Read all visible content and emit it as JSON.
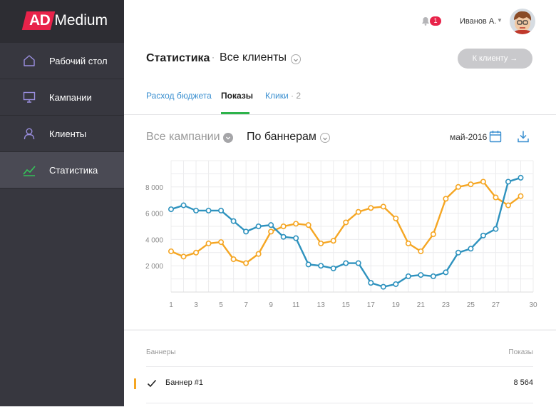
{
  "app": {
    "logo_highlight": "AD",
    "logo_rest": "Medium",
    "brand_color": "#e8234a"
  },
  "sidebar": {
    "items": [
      {
        "label": "Рабочий стол",
        "icon": "home-icon",
        "active": false
      },
      {
        "label": "Кампании",
        "icon": "monitor-icon",
        "active": false
      },
      {
        "label": "Клиенты",
        "icon": "user-icon",
        "active": false
      },
      {
        "label": "Статистика",
        "icon": "chart-line-icon",
        "active": true
      }
    ]
  },
  "topbar": {
    "notifications_count": "1",
    "user_name": "Иванов А."
  },
  "header": {
    "title": "Статистика",
    "separator": "·",
    "client": "Все клиенты",
    "cta_label": "К клиенту  →",
    "tabs": [
      {
        "label": "Расход бюджета",
        "active": false
      },
      {
        "label": "Показы",
        "active": true
      },
      {
        "label": "Клики",
        "count": "· 2",
        "active": false
      }
    ]
  },
  "filters": {
    "campaigns": "Все кампании",
    "grouping": "По баннерам",
    "period": "май-2016"
  },
  "chart_data": {
    "type": "line",
    "x": [
      1,
      2,
      3,
      4,
      5,
      6,
      7,
      8,
      9,
      10,
      11,
      12,
      13,
      14,
      15,
      16,
      17,
      18,
      19,
      20,
      21,
      22,
      23,
      24,
      25,
      26,
      27,
      28,
      29,
      30
    ],
    "x_tick_labels": [
      "1",
      "3",
      "5",
      "7",
      "9",
      "11",
      "13",
      "15",
      "17",
      "19",
      "21",
      "23",
      "25",
      "27",
      "30"
    ],
    "y_tick_labels": [
      "2 000",
      "4 000",
      "6 000",
      "8 000"
    ],
    "ylim": [
      0,
      10000
    ],
    "grid": true,
    "series": [
      {
        "color": "#2e92be",
        "values": [
          6300,
          6600,
          6200,
          6200,
          6200,
          5400,
          4600,
          5000,
          5100,
          4200,
          4100,
          2100,
          2000,
          1800,
          2200,
          2200,
          700,
          400,
          600,
          1200,
          1300,
          1200,
          1500,
          3000,
          3300,
          4300,
          4800,
          8400,
          8700,
          null
        ]
      },
      {
        "color": "#f5a623",
        "values": [
          3100,
          2700,
          3000,
          3700,
          3800,
          2500,
          2200,
          2900,
          4600,
          5000,
          5200,
          5100,
          3700,
          3900,
          5300,
          6100,
          6400,
          6500,
          5600,
          3700,
          3100,
          4400,
          7100,
          8000,
          8200,
          8400,
          7200,
          6600,
          7300,
          null
        ]
      }
    ]
  },
  "table": {
    "col_name": "Баннеры",
    "col_value": "Показы",
    "rows": [
      {
        "name": "Баннер #1",
        "value": "8 564",
        "checked": true,
        "marker_color": "#f5a623"
      }
    ]
  }
}
